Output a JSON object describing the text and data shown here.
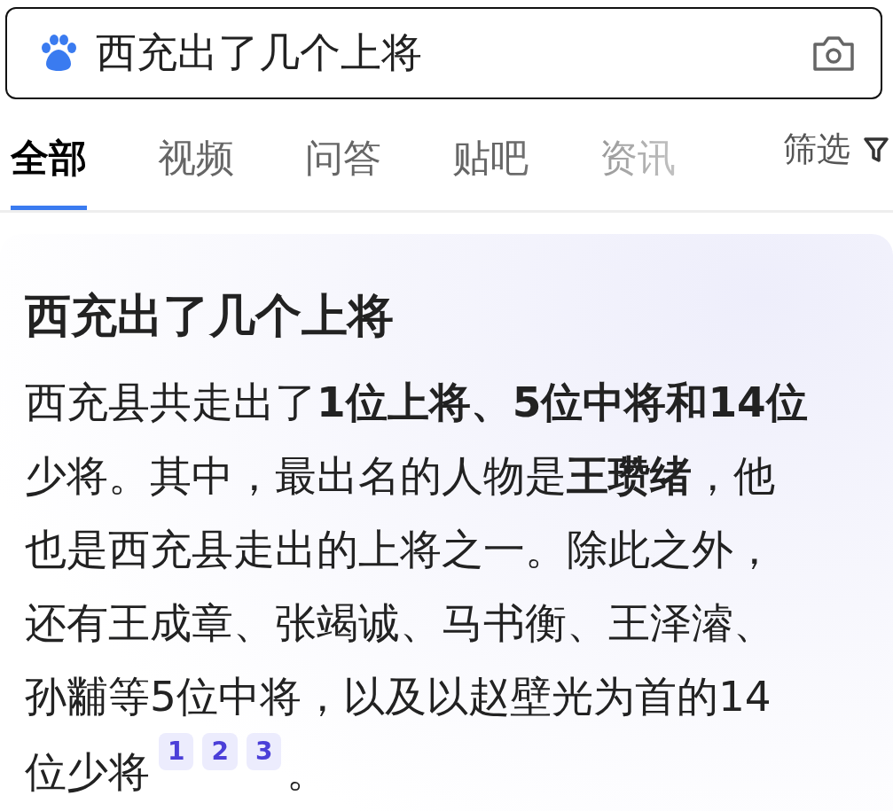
{
  "search": {
    "value": "西充出了几个上将"
  },
  "tabs": [
    {
      "label": "全部",
      "selected": true
    },
    {
      "label": "视频",
      "selected": false
    },
    {
      "label": "问答",
      "selected": false
    },
    {
      "label": "贴吧",
      "selected": false
    },
    {
      "label": "资讯",
      "selected": false
    }
  ],
  "filter": {
    "label": "筛选"
  },
  "answer": {
    "title": "西充出了几个上将",
    "lines": [
      "西充县共走出了**1位上将、5位中将和14位**",
      "少将。其中，最出名的人物是**王瓒绪**，他",
      "也是西充县走出的上将之一。除此之外，",
      "还有王成章、张竭诚、马书衡、王泽濬、",
      "孙黼等5位中将，以及以赵壁光为首的14",
      "位少将"
    ],
    "citations": [
      "1",
      "2",
      "3"
    ],
    "ending": "。"
  }
}
